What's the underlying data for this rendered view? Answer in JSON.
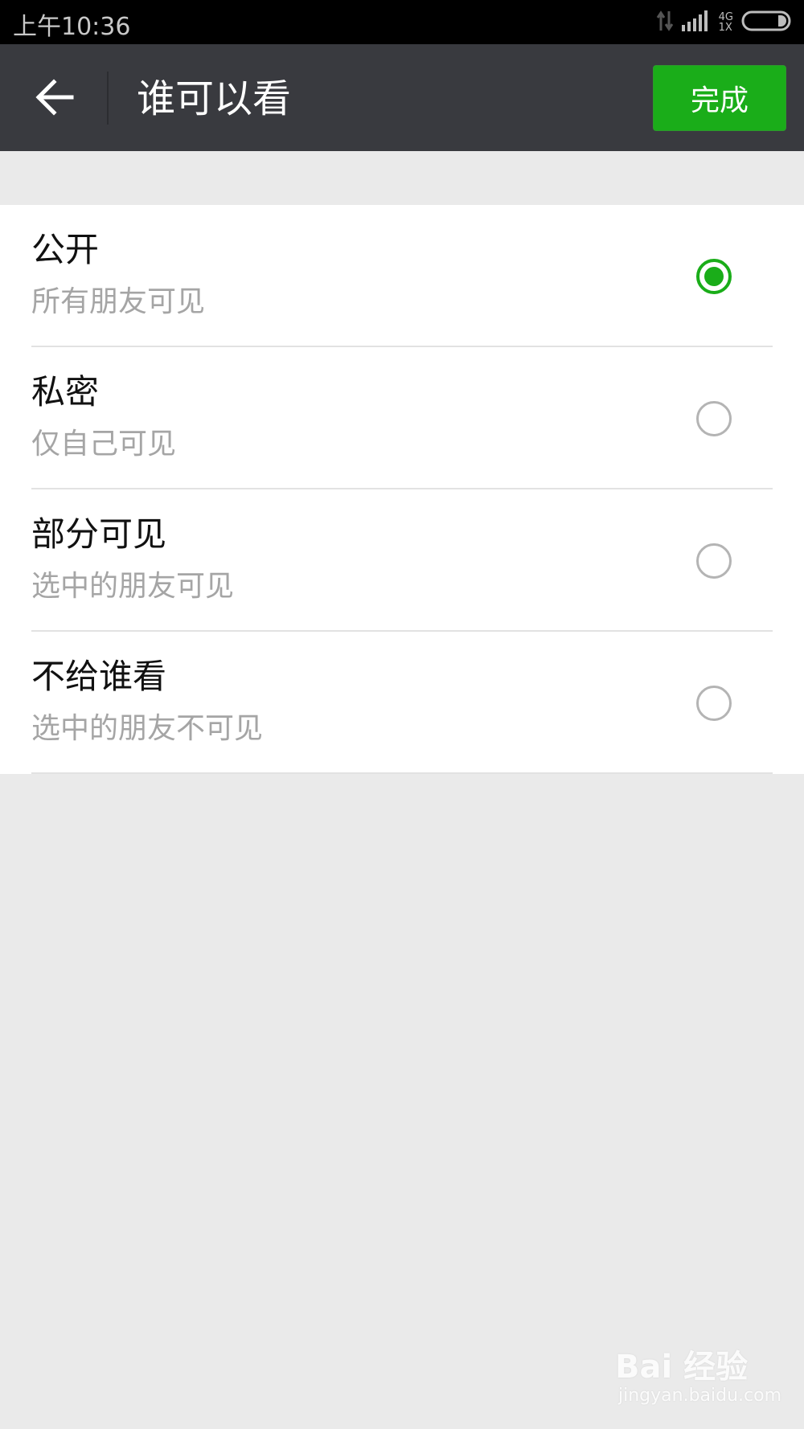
{
  "status_bar": {
    "time": "上午10:36",
    "network_top": "4G",
    "network_bottom": "1X",
    "icons": [
      "data-transfer-icon",
      "signal-icon",
      "battery-icon"
    ]
  },
  "toolbar": {
    "title": "谁可以看",
    "back_icon": "arrow-left-icon",
    "done_label": "完成"
  },
  "options": [
    {
      "title": "公开",
      "subtitle": "所有朋友可见",
      "selected": true
    },
    {
      "title": "私密",
      "subtitle": "仅自己可见",
      "selected": false
    },
    {
      "title": "部分可见",
      "subtitle": "选中的朋友可见",
      "selected": false
    },
    {
      "title": "不给谁看",
      "subtitle": "选中的朋友不可见",
      "selected": false
    }
  ],
  "watermark": {
    "brand": "Bai 经验",
    "url": "jingyan.baidu.com"
  },
  "colors": {
    "accent": "#1aad19",
    "toolbar_bg": "#393a3f",
    "page_bg": "#eaeaea",
    "subtitle": "#a5a5a5"
  }
}
